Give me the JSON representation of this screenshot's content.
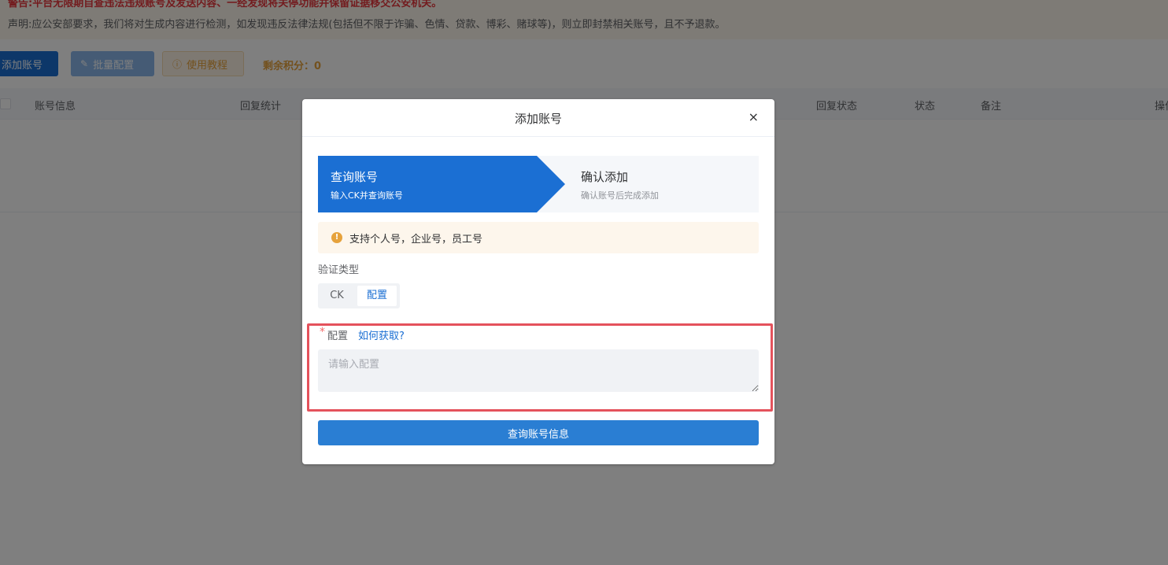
{
  "notice": {
    "warning": "警告:平台无限期自查违法违规账号及发送内容、一经发现将关停功能并保留证据移交公安机关。",
    "declaration": "声明:应公安部要求，我们将对生成内容进行检测，如发现违反法律法规(包括但不限于诈骗、色情、贷款、博彩、赌球等)，则立即封禁相关账号，且不予退款。"
  },
  "toolbar": {
    "add_label": "添加账号",
    "batch_label": "批量配置",
    "tutorial_label": "使用教程",
    "credits_label": "剩余积分：",
    "credits_value": "0"
  },
  "table": {
    "columns": [
      "账号信息",
      "回复统计",
      "回复状态",
      "状态",
      "备注",
      "操作"
    ]
  },
  "dialog": {
    "title": "添加账号",
    "close_glyph": "×",
    "steps": [
      {
        "title": "查询账号",
        "subtitle": "输入CK并查询账号"
      },
      {
        "title": "确认添加",
        "subtitle": "确认账号后完成添加"
      }
    ],
    "alert_text": "支持个人号，企业号，员工号",
    "verify_type_label": "验证类型",
    "verify_options": [
      "CK",
      "配置"
    ],
    "selected_option": "配置",
    "field": {
      "required_mark": "*",
      "label": "配置",
      "help_link": "如何获取?",
      "placeholder": "请输入配置",
      "value": ""
    },
    "submit_label": "查询账号信息"
  },
  "colors": {
    "primary": "#1b6fd3",
    "warning": "#e6a23c",
    "danger": "#e4525c"
  }
}
